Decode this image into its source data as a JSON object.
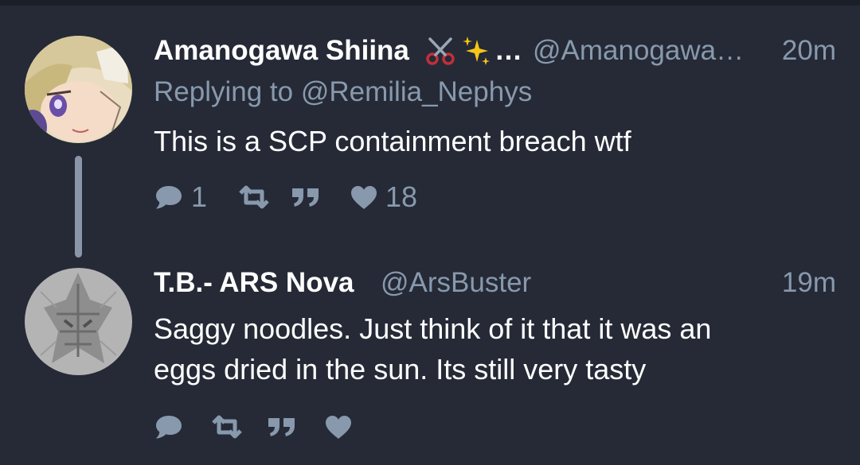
{
  "tweets": [
    {
      "name": "Amanogawa Shiina",
      "name_emoji": "✂️✨…",
      "handle": "@Amanogawa…",
      "time": "20m",
      "replying_prefix": "Replying to",
      "replying_to": "@Remilia_Nephys",
      "text_lines": [
        "This is a SCP containment breach wtf"
      ],
      "actions": {
        "reply_count": "1",
        "retweet_count": "",
        "like_count": "18"
      }
    },
    {
      "name": "T.B.- ARS Nova",
      "handle": "@ArsBuster",
      "time": "19m",
      "text_lines": [
        "Saggy noodles. Just think of it that it was an",
        "eggs dried in the sun. Its still very tasty"
      ],
      "actions": {
        "reply_count": "",
        "retweet_count": "",
        "like_count": ""
      }
    }
  ],
  "colors": {
    "background": "#252a36",
    "primary_text": "#ffffff",
    "secondary_text": "#8899ad",
    "thread_line": "#8a95a8"
  },
  "icons": [
    "reply-icon",
    "retweet-icon",
    "quote-icon",
    "like-icon",
    "scissors-icon",
    "sparkles-icon"
  ]
}
